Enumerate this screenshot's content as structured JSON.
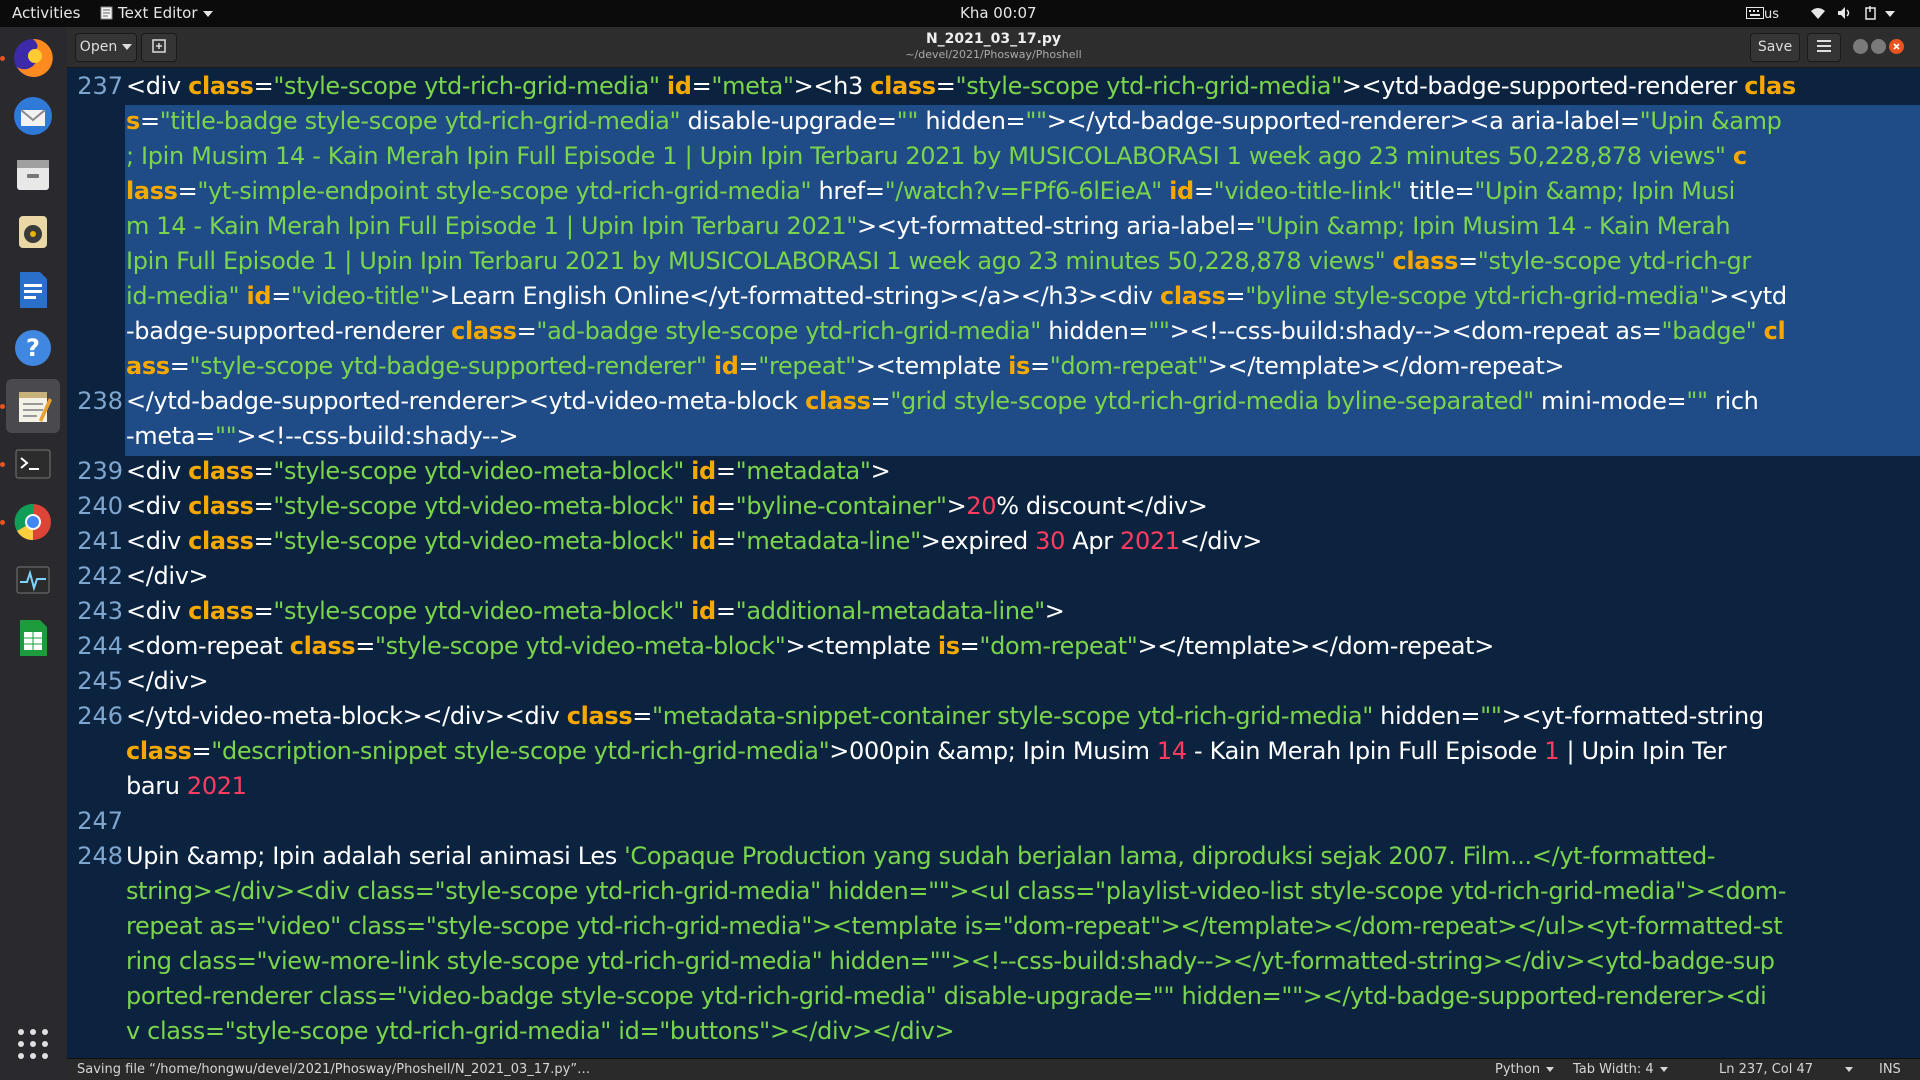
{
  "topbar": {
    "activities": "Activities",
    "app_menu": "Text Editor",
    "clock": "Kha 00:07",
    "keyboard_layout": "us",
    "icons": [
      "text-editor-icon",
      "keyboard-icon",
      "wifi-icon",
      "volume-icon",
      "power-icon"
    ]
  },
  "dock": {
    "items": [
      "firefox-icon",
      "thunderbird-icon",
      "files-icon",
      "rhythmbox-icon",
      "libreoffice-writer-icon",
      "help-icon",
      "text-editor-icon",
      "terminal-icon",
      "chrome-icon",
      "system-monitor-icon",
      "libreoffice-calc-icon"
    ],
    "active": "text-editor-icon",
    "show_apps_icon": "grid-icon"
  },
  "window": {
    "open_button": "Open",
    "title": "N_2021_03_17.py",
    "path": "~/devel/2021/Phosway/Phoshell",
    "save_button": "Save",
    "menu_icon": "hamburger-icon"
  },
  "editor": {
    "line_numbers": [
      "237",
      "238",
      "239",
      "240",
      "241",
      "242",
      "243",
      "244",
      "245",
      "246",
      "247",
      "248"
    ],
    "selected_line": "237",
    "lines": [
      {
        "tokens": [
          [
            "t",
            "<div "
          ],
          [
            "k",
            "class"
          ],
          [
            "t",
            "="
          ],
          [
            "s",
            "\"style-scope ytd-rich-grid-media\""
          ],
          [
            "t",
            " "
          ],
          [
            "k",
            "id"
          ],
          [
            "t",
            "="
          ],
          [
            "s",
            "\"meta\""
          ],
          [
            "t",
            "><h3 "
          ],
          [
            "k",
            "class"
          ],
          [
            "t",
            "="
          ],
          [
            "s",
            "\"style-scope ytd-rich-grid-media\""
          ],
          [
            "t",
            "><ytd-badge-supported-renderer "
          ],
          [
            "k",
            "clas"
          ]
        ]
      },
      {
        "tokens": [
          [
            "k",
            "s"
          ],
          [
            "t",
            "="
          ],
          [
            "s",
            "\"title-badge style-scope ytd-rich-grid-media\""
          ],
          [
            "t",
            " disable-upgrade="
          ],
          [
            "s",
            "\"\""
          ],
          [
            "t",
            " hidden="
          ],
          [
            "s",
            "\"\""
          ],
          [
            "t",
            "></ytd-badge-supported-renderer><a aria-label="
          ],
          [
            "s",
            "\"Upin &amp"
          ]
        ]
      },
      {
        "tokens": [
          [
            "s",
            "; Ipin Musim 14 - Kain Merah Ipin Full Episode 1 | Upin Ipin Terbaru 2021 by MUSICOLABORASI 1 week ago 23 minutes 50,228,878 views\""
          ],
          [
            "t",
            " "
          ],
          [
            "k",
            "c"
          ]
        ]
      },
      {
        "tokens": [
          [
            "k",
            "lass"
          ],
          [
            "t",
            "="
          ],
          [
            "s",
            "\"yt-simple-endpoint style-scope ytd-rich-grid-media\""
          ],
          [
            "t",
            " href="
          ],
          [
            "s",
            "\"/watch?v=FPf6-6lEieA\""
          ],
          [
            "t",
            " "
          ],
          [
            "k",
            "id"
          ],
          [
            "t",
            "="
          ],
          [
            "s",
            "\"video-title-link\""
          ],
          [
            "t",
            " title="
          ],
          [
            "s",
            "\"Upin &amp; Ipin Musi"
          ]
        ]
      },
      {
        "tokens": [
          [
            "s",
            "m 14 - Kain Merah Ipin Full Episode 1 | Upin Ipin Terbaru 2021\""
          ],
          [
            "t",
            "><yt-formatted-string aria-label="
          ],
          [
            "s",
            "\"Upin &amp; Ipin Musim 14 - Kain Merah"
          ]
        ]
      },
      {
        "tokens": [
          [
            "s",
            "Ipin Full Episode 1 | Upin Ipin Terbaru 2021 by MUSICOLABORASI 1 week ago 23 minutes 50,228,878 views\""
          ],
          [
            "t",
            " "
          ],
          [
            "k",
            "class"
          ],
          [
            "t",
            "="
          ],
          [
            "s",
            "\"style-scope ytd-rich-gr"
          ]
        ]
      },
      {
        "tokens": [
          [
            "s",
            "id-media\""
          ],
          [
            "t",
            " "
          ],
          [
            "k",
            "id"
          ],
          [
            "t",
            "="
          ],
          [
            "s",
            "\"video-title\""
          ],
          [
            "t",
            ">Learn English Online</yt-formatted-string></a></h3><div "
          ],
          [
            "k",
            "class"
          ],
          [
            "t",
            "="
          ],
          [
            "s",
            "\"byline style-scope ytd-rich-grid-media\""
          ],
          [
            "t",
            "><ytd"
          ]
        ]
      },
      {
        "tokens": [
          [
            "t",
            "-badge-supported-renderer "
          ],
          [
            "k",
            "class"
          ],
          [
            "t",
            "="
          ],
          [
            "s",
            "\"ad-badge style-scope ytd-rich-grid-media\""
          ],
          [
            "t",
            " hidden="
          ],
          [
            "s",
            "\"\""
          ],
          [
            "t",
            "><!--css-build:shady--><dom-repeat as="
          ],
          [
            "s",
            "\"badge\""
          ],
          [
            "t",
            " "
          ],
          [
            "k",
            "cl"
          ]
        ]
      },
      {
        "tokens": [
          [
            "k",
            "ass"
          ],
          [
            "t",
            "="
          ],
          [
            "s",
            "\"style-scope ytd-badge-supported-renderer\""
          ],
          [
            "t",
            " "
          ],
          [
            "k",
            "id"
          ],
          [
            "t",
            "="
          ],
          [
            "s",
            "\"repeat\""
          ],
          [
            "t",
            "><template "
          ],
          [
            "k",
            "is"
          ],
          [
            "t",
            "="
          ],
          [
            "s",
            "\"dom-repeat\""
          ],
          [
            "t",
            "></template></dom-repeat>"
          ]
        ]
      },
      {
        "tokens": [
          [
            "t",
            "</ytd-badge-supported-renderer><ytd-video-meta-block "
          ],
          [
            "k",
            "class"
          ],
          [
            "t",
            "="
          ],
          [
            "s",
            "\"grid style-scope ytd-rich-grid-media byline-separated\""
          ],
          [
            "t",
            " mini-mode="
          ],
          [
            "s",
            "\"\""
          ],
          [
            "t",
            " rich"
          ]
        ]
      },
      {
        "tokens": [
          [
            "t",
            "-meta="
          ],
          [
            "s",
            "\"\""
          ],
          [
            "t",
            "><!--css-build:shady-->"
          ]
        ]
      },
      {
        "tokens": [
          [
            "t",
            "<div "
          ],
          [
            "k",
            "class"
          ],
          [
            "t",
            "="
          ],
          [
            "s",
            "\"style-scope ytd-video-meta-block\""
          ],
          [
            "t",
            " "
          ],
          [
            "k",
            "id"
          ],
          [
            "t",
            "="
          ],
          [
            "s",
            "\"metadata\""
          ],
          [
            "t",
            ">"
          ]
        ]
      },
      {
        "tokens": [
          [
            "t",
            "<div "
          ],
          [
            "k",
            "class"
          ],
          [
            "t",
            "="
          ],
          [
            "s",
            "\"style-scope ytd-video-meta-block\""
          ],
          [
            "t",
            " "
          ],
          [
            "k",
            "id"
          ],
          [
            "t",
            "="
          ],
          [
            "s",
            "\"byline-container\""
          ],
          [
            "t",
            ">"
          ],
          [
            "n",
            "20"
          ],
          [
            "t",
            "% discount</div>"
          ]
        ]
      },
      {
        "tokens": [
          [
            "t",
            "<div "
          ],
          [
            "k",
            "class"
          ],
          [
            "t",
            "="
          ],
          [
            "s",
            "\"style-scope ytd-video-meta-block\""
          ],
          [
            "t",
            " "
          ],
          [
            "k",
            "id"
          ],
          [
            "t",
            "="
          ],
          [
            "s",
            "\"metadata-line\""
          ],
          [
            "t",
            ">expired "
          ],
          [
            "n",
            "30"
          ],
          [
            "t",
            " Apr "
          ],
          [
            "n",
            "2021"
          ],
          [
            "t",
            "</div>"
          ]
        ]
      },
      {
        "tokens": [
          [
            "t",
            "</div>"
          ]
        ]
      },
      {
        "tokens": [
          [
            "t",
            "<div "
          ],
          [
            "k",
            "class"
          ],
          [
            "t",
            "="
          ],
          [
            "s",
            "\"style-scope ytd-video-meta-block\""
          ],
          [
            "t",
            " "
          ],
          [
            "k",
            "id"
          ],
          [
            "t",
            "="
          ],
          [
            "s",
            "\"additional-metadata-line\""
          ],
          [
            "t",
            ">"
          ]
        ]
      },
      {
        "tokens": [
          [
            "t",
            "<dom-repeat "
          ],
          [
            "k",
            "class"
          ],
          [
            "t",
            "="
          ],
          [
            "s",
            "\"style-scope ytd-video-meta-block\""
          ],
          [
            "t",
            "><template "
          ],
          [
            "k",
            "is"
          ],
          [
            "t",
            "="
          ],
          [
            "s",
            "\"dom-repeat\""
          ],
          [
            "t",
            "></template></dom-repeat>"
          ]
        ]
      },
      {
        "tokens": [
          [
            "t",
            "</div>"
          ]
        ]
      },
      {
        "tokens": [
          [
            "t",
            "</ytd-video-meta-block></div><div "
          ],
          [
            "k",
            "class"
          ],
          [
            "t",
            "="
          ],
          [
            "s",
            "\"metadata-snippet-container style-scope ytd-rich-grid-media\""
          ],
          [
            "t",
            " hidden="
          ],
          [
            "s",
            "\"\""
          ],
          [
            "t",
            "><yt-formatted-string"
          ]
        ]
      },
      {
        "tokens": [
          [
            "k",
            "class"
          ],
          [
            "t",
            "="
          ],
          [
            "s",
            "\"description-snippet style-scope ytd-rich-grid-media\""
          ],
          [
            "t",
            ">000pin &amp; Ipin Musim "
          ],
          [
            "n",
            "14"
          ],
          [
            "t",
            " - Kain Merah Ipin Full Episode "
          ],
          [
            "n",
            "1"
          ],
          [
            "t",
            " | Upin Ipin Ter"
          ]
        ]
      },
      {
        "tokens": [
          [
            "t",
            "baru "
          ],
          [
            "n",
            "2021"
          ]
        ]
      },
      {
        "tokens": []
      },
      {
        "tokens": [
          [
            "t",
            "Upin &amp; Ipin adalah serial animasi Les "
          ],
          [
            "g",
            "'Copaque Production yang sudah berjalan lama, diproduksi sejak 2007. Film...</yt-formatted-"
          ]
        ]
      },
      {
        "tokens": [
          [
            "g",
            "string></div><div class=\"style-scope ytd-rich-grid-media\" hidden=\"\"><ul class=\"playlist-video-list style-scope ytd-rich-grid-media\"><dom-"
          ]
        ]
      },
      {
        "tokens": [
          [
            "g",
            "repeat as=\"video\" class=\"style-scope ytd-rich-grid-media\"><template is=\"dom-repeat\"></template></dom-repeat></ul><yt-formatted-st"
          ]
        ]
      },
      {
        "tokens": [
          [
            "g",
            "ring class=\"view-more-link style-scope ytd-rich-grid-media\" hidden=\"\"><!--css-build:shady--></yt-formatted-string></div><ytd-badge-sup"
          ]
        ]
      },
      {
        "tokens": [
          [
            "g",
            "ported-renderer class=\"video-badge style-scope ytd-rich-grid-media\" disable-upgrade=\"\" hidden=\"\"></ytd-badge-supported-renderer><di"
          ]
        ]
      },
      {
        "tokens": [
          [
            "g",
            "v class=\"style-scope ytd-rich-grid-media\" id=\"buttons\"></div></div>"
          ]
        ]
      }
    ]
  },
  "status": {
    "message": "Saving file “/home/hongwu/devel/2021/Phosway/Phoshell/N_2021_03_17.py”…",
    "language": "Python",
    "tab_width": "Tab Width: 4",
    "cursor": "Ln 237, Col 47",
    "mode": "INS"
  },
  "colors": {
    "editor_bg": "#0c2340",
    "selection_bg": "#1f4b87",
    "keyword": "#f5a800",
    "string": "#7bd54c",
    "number": "#ff3c5f",
    "line_number": "#7fa6cf"
  }
}
